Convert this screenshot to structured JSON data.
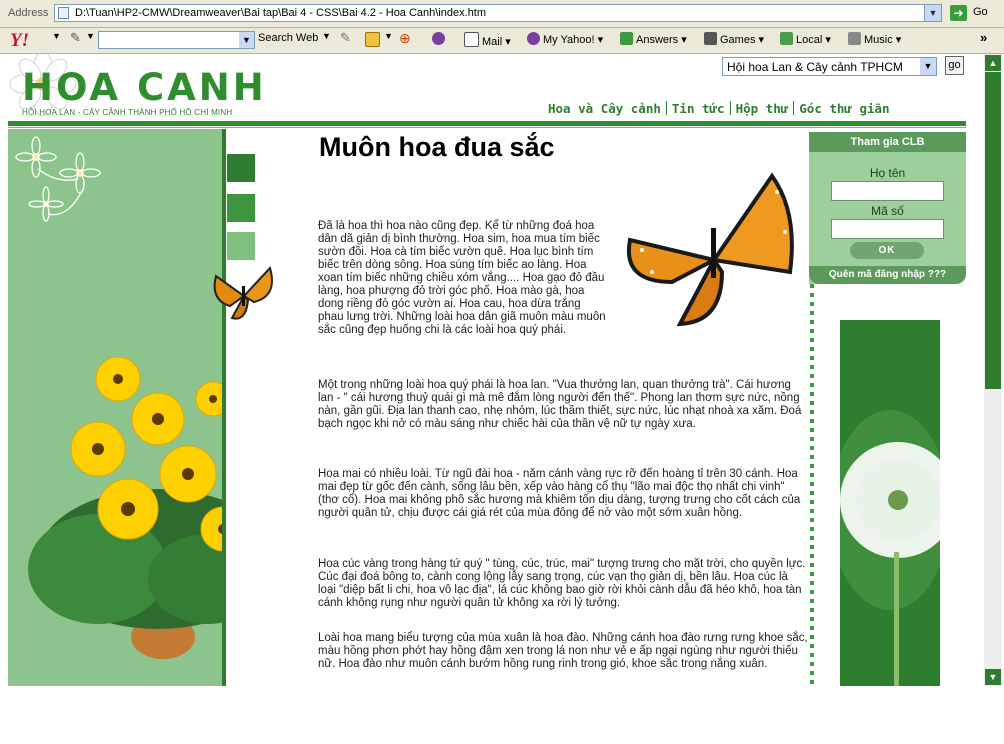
{
  "browser": {
    "address_label": "Address",
    "address_value": "D:\\Tuan\\HP2-CMW\\Dreamweaver\\Bai tap\\Bai 4 - CSS\\Bai 4.2 - Hoa Canh\\index.htm",
    "go_label": "Go",
    "toolbar": {
      "search_web": "Search Web",
      "mail": "Mail",
      "my_yahoo": "My Yahoo!",
      "answers": "Answers",
      "games": "Games",
      "local": "Local",
      "music": "Music",
      "more": "»"
    }
  },
  "header": {
    "logo_text": "HOA CANH",
    "logo_subtitle": "HỘI HOA LAN - CÂY CẢNH THÀNH PHỐ HỒ CHÍ MINH",
    "club_select": "Hội hoa Lan & Cây cảnh TPHCM",
    "go_button": "go",
    "nav": [
      "Hoa và Cây cảnh",
      "Tin tức",
      "Hộp thư",
      "Góc thư giãn"
    ]
  },
  "login": {
    "title": "Tham gia CLB",
    "name_label": "Họ tên",
    "code_label": "Mã số",
    "ok_button": "OK",
    "forgot": "Quên mã đăng nhập ???"
  },
  "article": {
    "title": "Muôn hoa đua sắc",
    "paragraphs": [
      "Đã là hoa thì hoa nào cũng đẹp. Kể từ những đoá hoa dân dã giản dị bình thường. Hoa sim, hoa mua tím biếc sườn đồi. Hoa cà tím biếc vườn quê. Hoa lục bình tím biếc trên dòng sông. Hoa súng tím biếc ao làng. Hoa xoan tím biếc những chiều xóm vắng.... Hoa gạo đỏ đầu làng, hoa phượng đỏ trời góc phố. Hoa mào gà, hoa dong riềng đỏ góc vườn ai. Hoa cau, hoa dừa trắng phau lưng trời. Những loài hoa dân giã muôn màu muôn sắc cũng đẹp huống chi là các loài hoa quý phái.",
      "Một trong những loài hoa quý phái là hoa lan. \"Vua thưởng lan, quan thưởng trà\". Cái hương lan - \" cái hương thuỷ quái gì mà mê đắm lòng người đến thế\". Phong lan thơm sực nức, nồng nàn, gần gũi. Địa lan thanh cao, nhẹ nhỏm, lúc thầm thiết, sực nức, lúc nhạt nhoà xa xăm. Đoá bạch ngọc khi nở có màu sáng như chiếc hài của thần vệ nữ tự ngày xưa.",
      "Hoa mai có nhiều loài. Từ ngũ đài hoa - năm cánh vàng rực rỡ đến hoàng tỉ trên 30 cánh. Hoa mai đẹp từ gốc đến cành, sống lâu bền, xếp vào hàng cổ thụ \"lão mai độc thọ nhất chi vinh\" (thơ cổ). Hoa mai không phô sắc hương mà khiêm tốn dịu dàng, tượng trưng cho cốt cách của người quân tử, chịu được cái giá rét của mùa đông để nở vào một sớm xuân hồng.",
      "Hoa cúc vàng trong hàng tứ quý \" tùng, cúc, trúc, mai\" tượng trưng cho mặt trời, cho quyền lực. Cúc đại đoá bông to, cành cong lộng lẫy sang trọng, cúc vạn thọ giản dị, bền lâu. Hoa cúc là loại \"diệp bất li chi, hoa vô lạc địa\", lá cúc không bao giờ rời khỏi cành dẫu đã héo khô, hoa tàn cánh không rụng như người quân tử không xa rời lý tưởng.",
      "Loài hoa mang biểu tượng của mùa xuân là hoa đào. Những cánh hoa đào rưng rưng khoe sắc, màu hồng phơn phớt hay hồng đậm xen trong lá non như vẻ e ấp ngại ngùng như người thiếu nữ. Hoa đào như muôn cánh bướm hồng rung rinh trong gió, khoe sắc trong nắng xuân."
    ]
  },
  "colors": {
    "brand_green": "#2f8d2f",
    "dark_green": "#2f7d2f",
    "light_green": "#8dc48d"
  }
}
